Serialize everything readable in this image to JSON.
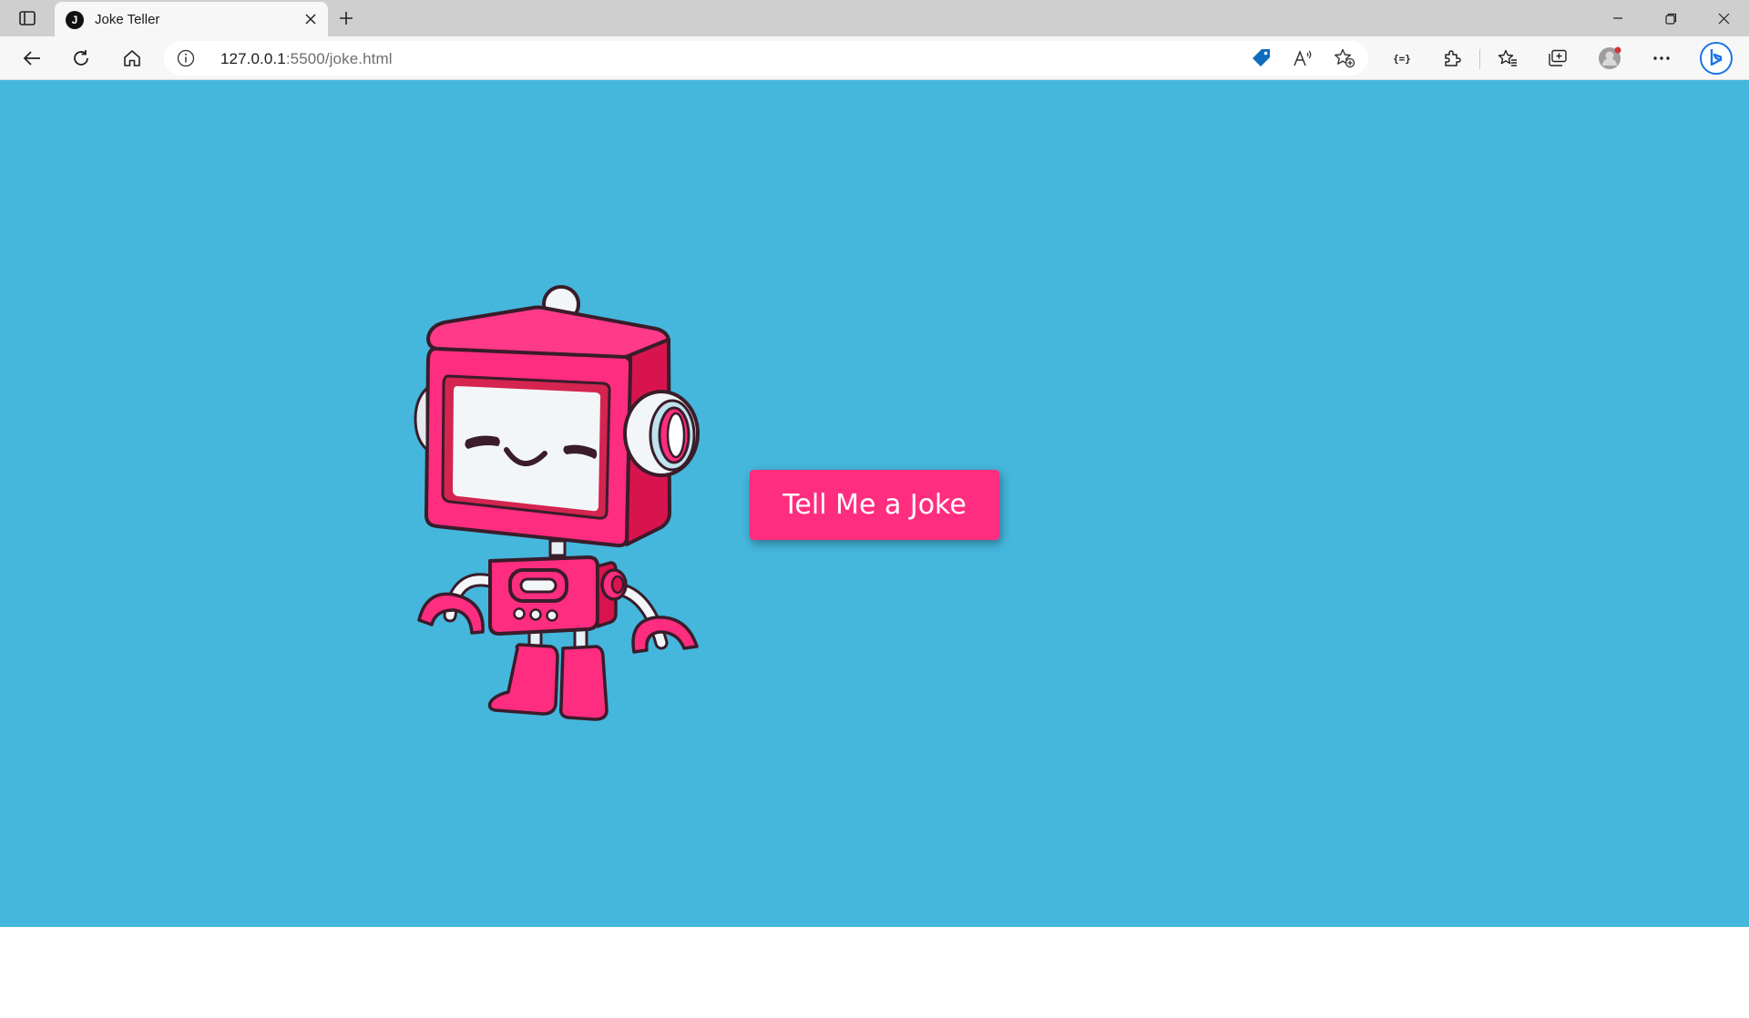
{
  "browser": {
    "tab": {
      "favicon_letter": "J",
      "title": "Joke Teller"
    },
    "address": {
      "host": "127.0.0.1",
      "path": ":5500/joke.html"
    }
  },
  "page": {
    "background_color": "#45b6dc",
    "button": {
      "label": "Tell Me a Joke",
      "color": "#ff2d7f"
    },
    "image": {
      "subject": "robot-illustration"
    }
  }
}
